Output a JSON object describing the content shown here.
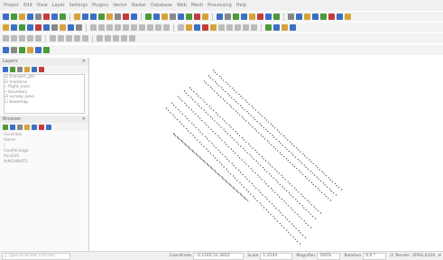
{
  "menubar": {
    "items": [
      "Project",
      "Edit",
      "View",
      "Layer",
      "Settings",
      "Plugins",
      "Vector",
      "Raster",
      "Database",
      "Web",
      "Mesh",
      "Processing",
      "Help"
    ]
  },
  "toolbars": {
    "row1_colors": [
      "#3b6fc4",
      "#4a9a3a",
      "#d8a23a",
      "#3b6fc4",
      "#888888",
      "#c43b3b",
      "#3b6fc4",
      "#4a9a3a",
      "#d8a23a",
      "#3b6fc4",
      "#3b6fc4",
      "#4a9a3a",
      "#d8a23a",
      "#888888",
      "#c43b3b",
      "#3b6fc4",
      "#4a9a3a",
      "#3b6fc4",
      "#d8a23a",
      "#888888",
      "#3b6fc4",
      "#4a9a3a",
      "#c43b3b",
      "#d8a23a",
      "#3b6fc4",
      "#888888",
      "#4a9a3a",
      "#3b6fc4",
      "#d8a23a",
      "#c43b3b",
      "#3b6fc4",
      "#4a9a3a",
      "#888888",
      "#3b6fc4",
      "#d8a23a",
      "#3b6fc4",
      "#4a9a3a",
      "#c43b3b",
      "#3b6fc4",
      "#d8a23a"
    ],
    "row2_colors": [
      "#d8a23a",
      "#3b6fc4",
      "#4a9a3a",
      "#3b6fc4",
      "#c43b3b",
      "#3b6fc4",
      "#888888",
      "#d8a23a",
      "#3b6fc4",
      "#888888",
      "#bbbbbb",
      "#bbbbbb",
      "#bbbbbb",
      "#bbbbbb",
      "#bbbbbb",
      "#bbbbbb",
      "#bbbbbb",
      "#bbbbbb",
      "#bbbbbb",
      "#bbbbbb",
      "#bbbbbb",
      "#d8a23a",
      "#3b6fc4",
      "#c43b3b",
      "#d8a23a",
      "#bbbbbb",
      "#bbbbbb",
      "#bbbbbb",
      "#bbbbbb",
      "#bbbbbb",
      "#4a9a3a",
      "#3b6fc4",
      "#d8a23a",
      "#3b6fc4"
    ],
    "row3_colors": [
      "#bbbbbb",
      "#bbbbbb",
      "#bbbbbb",
      "#bbbbbb",
      "#bbbbbb",
      "#bbbbbb",
      "#bbbbbb",
      "#bbbbbb",
      "#bbbbbb",
      "#bbbbbb",
      "#bbbbbb",
      "#bbbbbb",
      "#bbbbbb",
      "#bbbbbb",
      "#bbbbbb"
    ],
    "row4_colors": [
      "#3b6fc4",
      "#888888",
      "#4a9a3a",
      "#d8a23a",
      "#3b6fc4",
      "#4a9a3a"
    ]
  },
  "layers_panel": {
    "title": "Layers",
    "toolbar_colors": [
      "#3b6fc4",
      "#4a9a3a",
      "#888888",
      "#d8a23a",
      "#3b6fc4",
      "#c43b3b"
    ],
    "tree": [
      "☑ transect_pts",
      "☑ trackline",
      "  ─ flight_lines",
      "  ─ boundary",
      "☑ survey_area",
      "☐ basemap"
    ]
  },
  "browser_panel": {
    "title": "Browser",
    "toolbar_colors": [
      "#4a9a3a",
      "#3b6fc4",
      "#888888",
      "#d8a23a",
      "#3b6fc4",
      "#c43b3b",
      "#3b6fc4"
    ],
    "items": [
      "Favorites",
      "Home",
      "/",
      "GeoPackage",
      "PostGIS",
      "WMS/WMTS"
    ]
  },
  "statusbar": {
    "locator_placeholder": "Type to locate (Ctrl+K)",
    "coordinate_label": "Coordinate",
    "coordinate": "-3.1240,52.4812",
    "scale_label": "Scale",
    "scale": "1:2544",
    "magnifier_label": "Magnifier",
    "magnifier": "100%",
    "rotation_label": "Rotation",
    "rotation": "0.0 °",
    "render_label": "Render",
    "crs": "EPSG:4326"
  },
  "map": {
    "point_color": "#5a5a5a"
  }
}
